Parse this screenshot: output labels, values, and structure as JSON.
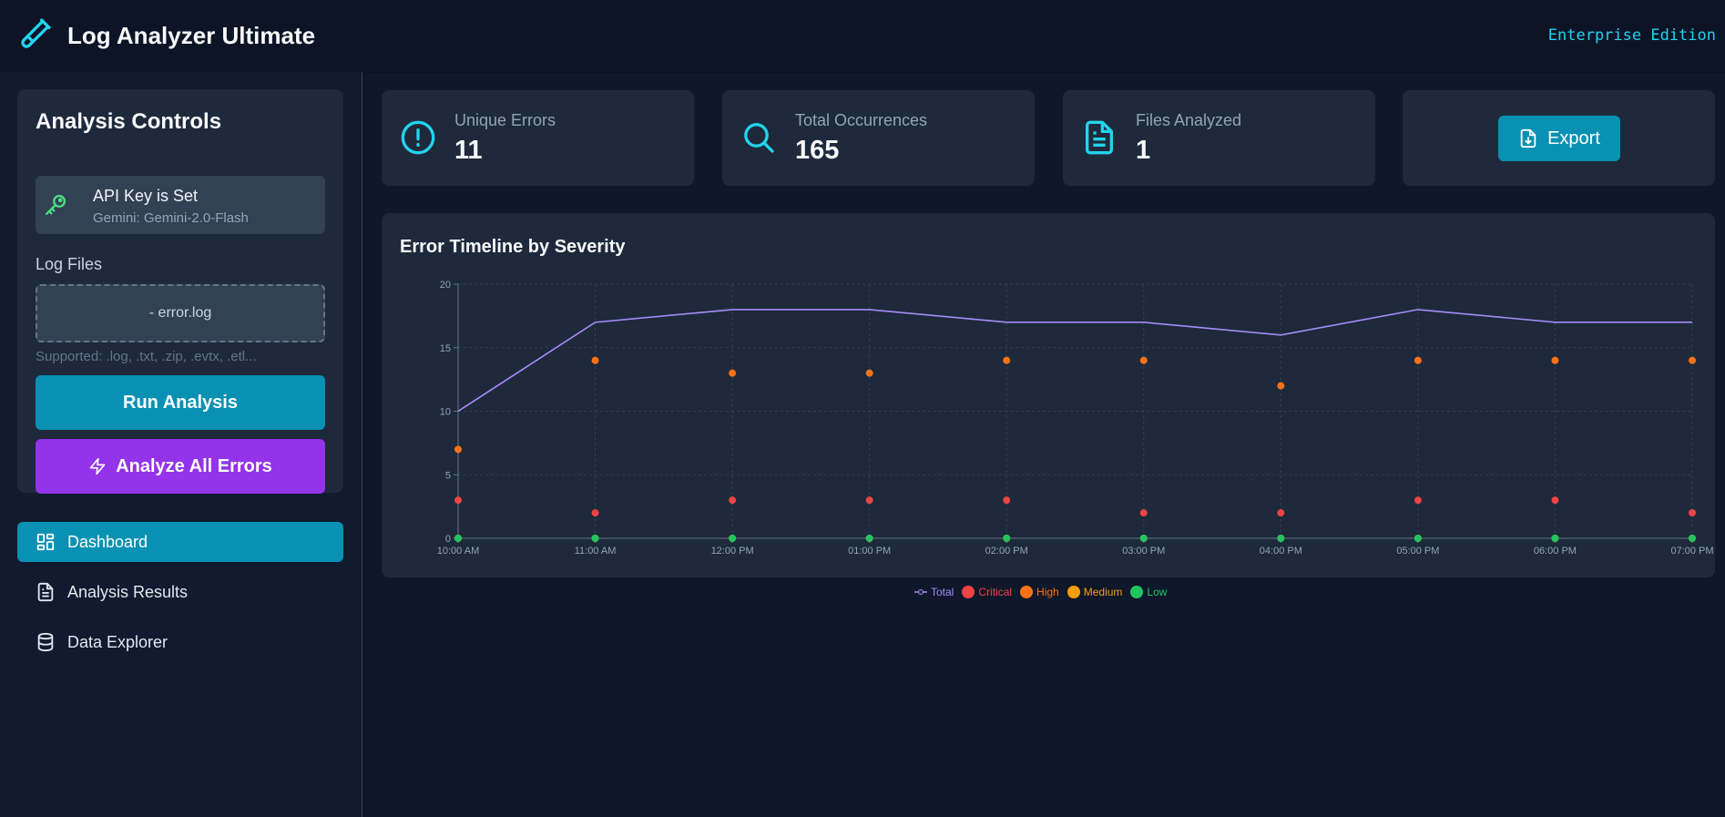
{
  "header": {
    "title": "Log Analyzer Ultimate",
    "edition": "Enterprise Edition",
    "logo_icon": "test-tube-icon"
  },
  "sidebar": {
    "controls_title": "Analysis Controls",
    "api_key": {
      "status": "API Key is Set",
      "model": "Gemini: Gemini-2.0-Flash",
      "icon": "key-icon"
    },
    "log_files_label": "Log Files",
    "files": "- error.log",
    "supported": "Supported: .log, .txt, .zip, .evtx, .etl...",
    "run_button": "Run Analysis",
    "analyze_all_button": "Analyze All Errors",
    "nav": [
      {
        "label": "Dashboard",
        "icon": "dashboard-grid-icon",
        "active": true
      },
      {
        "label": "Analysis Results",
        "icon": "document-icon",
        "active": false
      },
      {
        "label": "Data Explorer",
        "icon": "database-icon",
        "active": false
      }
    ]
  },
  "stats": [
    {
      "label": "Unique Errors",
      "value": "11",
      "icon": "alert-circle-icon"
    },
    {
      "label": "Total Occurrences",
      "value": "165",
      "icon": "search-icon"
    },
    {
      "label": "Files Analyzed",
      "value": "1",
      "icon": "file-text-icon"
    }
  ],
  "export_button": "Export",
  "colors": {
    "accent": "#0891b2",
    "purple": "#9333ea",
    "total": "#a78bfa",
    "critical": "#ef4444",
    "high": "#f97316",
    "medium": "#f59e0b",
    "low": "#22c55e"
  },
  "chart_data": {
    "type": "line",
    "title": "Error Timeline by Severity",
    "categories": [
      "10:00 AM",
      "11:00 AM",
      "12:00 PM",
      "01:00 PM",
      "02:00 PM",
      "03:00 PM",
      "04:00 PM",
      "05:00 PM",
      "06:00 PM",
      "07:00 PM"
    ],
    "ylim": [
      0,
      20
    ],
    "yticks": [
      0,
      5,
      10,
      15,
      20
    ],
    "grid": true,
    "legend_position": "bottom",
    "series": [
      {
        "name": "Total",
        "style": "line",
        "values": [
          10,
          17,
          18,
          18,
          17,
          17,
          16,
          18,
          17,
          17
        ]
      },
      {
        "name": "Critical",
        "style": "points",
        "values": [
          3,
          2,
          3,
          3,
          3,
          2,
          2,
          3,
          3,
          2
        ]
      },
      {
        "name": "High",
        "style": "points",
        "values": [
          7,
          14,
          13,
          13,
          14,
          14,
          12,
          14,
          14,
          14
        ]
      },
      {
        "name": "Medium",
        "style": "points",
        "values": [
          0,
          0,
          0,
          0,
          0,
          0,
          0,
          0,
          0,
          0
        ]
      },
      {
        "name": "Low",
        "style": "points",
        "values": [
          0,
          0,
          0,
          0,
          0,
          0,
          0,
          0,
          0,
          0
        ]
      }
    ]
  }
}
